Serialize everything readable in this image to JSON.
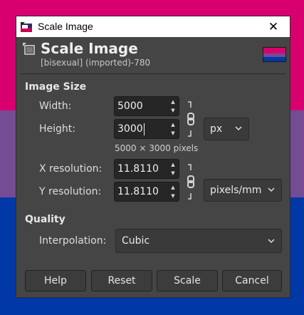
{
  "background": {
    "stripes": [
      "#d8006f",
      "#744c94",
      "#0038a8"
    ]
  },
  "window": {
    "title": "Scale Image",
    "close_glyph": "✕"
  },
  "header": {
    "title": "Scale Image",
    "subtitle": "[bisexual] (imported)-780"
  },
  "image_size": {
    "section_label": "Image Size",
    "width_label": "Width:",
    "width_value": "5000",
    "height_label": "Height:",
    "height_value": "3000",
    "size_unit": "px",
    "pixel_info": "5000 × 3000 pixels",
    "xres_label": "X resolution:",
    "xres_value": "11.8110",
    "yres_label": "Y resolution:",
    "yres_value": "11.8110",
    "res_unit": "pixels/mm"
  },
  "quality": {
    "section_label": "Quality",
    "interp_label": "Interpolation:",
    "interp_value": "Cubic"
  },
  "buttons": {
    "help": "Help",
    "reset": "Reset",
    "scale": "Scale",
    "cancel": "Cancel"
  },
  "icons": {
    "window": "gimp-scale-icon",
    "header": "scale-image-icon",
    "chain": "chain-link-icon",
    "dropdown": "chevron-down-icon",
    "spin_up": "spin-up-arrow-icon",
    "spin_down": "spin-down-arrow-icon"
  }
}
